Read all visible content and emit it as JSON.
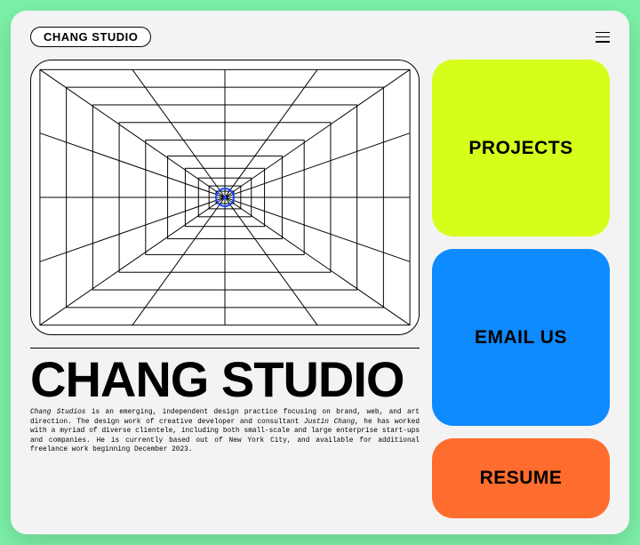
{
  "header": {
    "logo": "CHANG STUDIO"
  },
  "hero": {
    "title": "CHANG STUDIO",
    "body_prefix_em": "Chang Studios",
    "body_mid1": " is an emerging, independent design practice focusing on brand, web, and art direction. The design work of creative developer and consultant ",
    "body_name_em": "Justin Chang",
    "body_mid2": ", he has worked with a myriad of diverse clientele, including both small-scale and large enterprise start-ups and companies. He is currently based out of New York City, and available for additional freelance work beginning December 2023."
  },
  "cards": {
    "projects": "PROJECTS",
    "email": "EMAIL US",
    "resume": "RESUME"
  }
}
